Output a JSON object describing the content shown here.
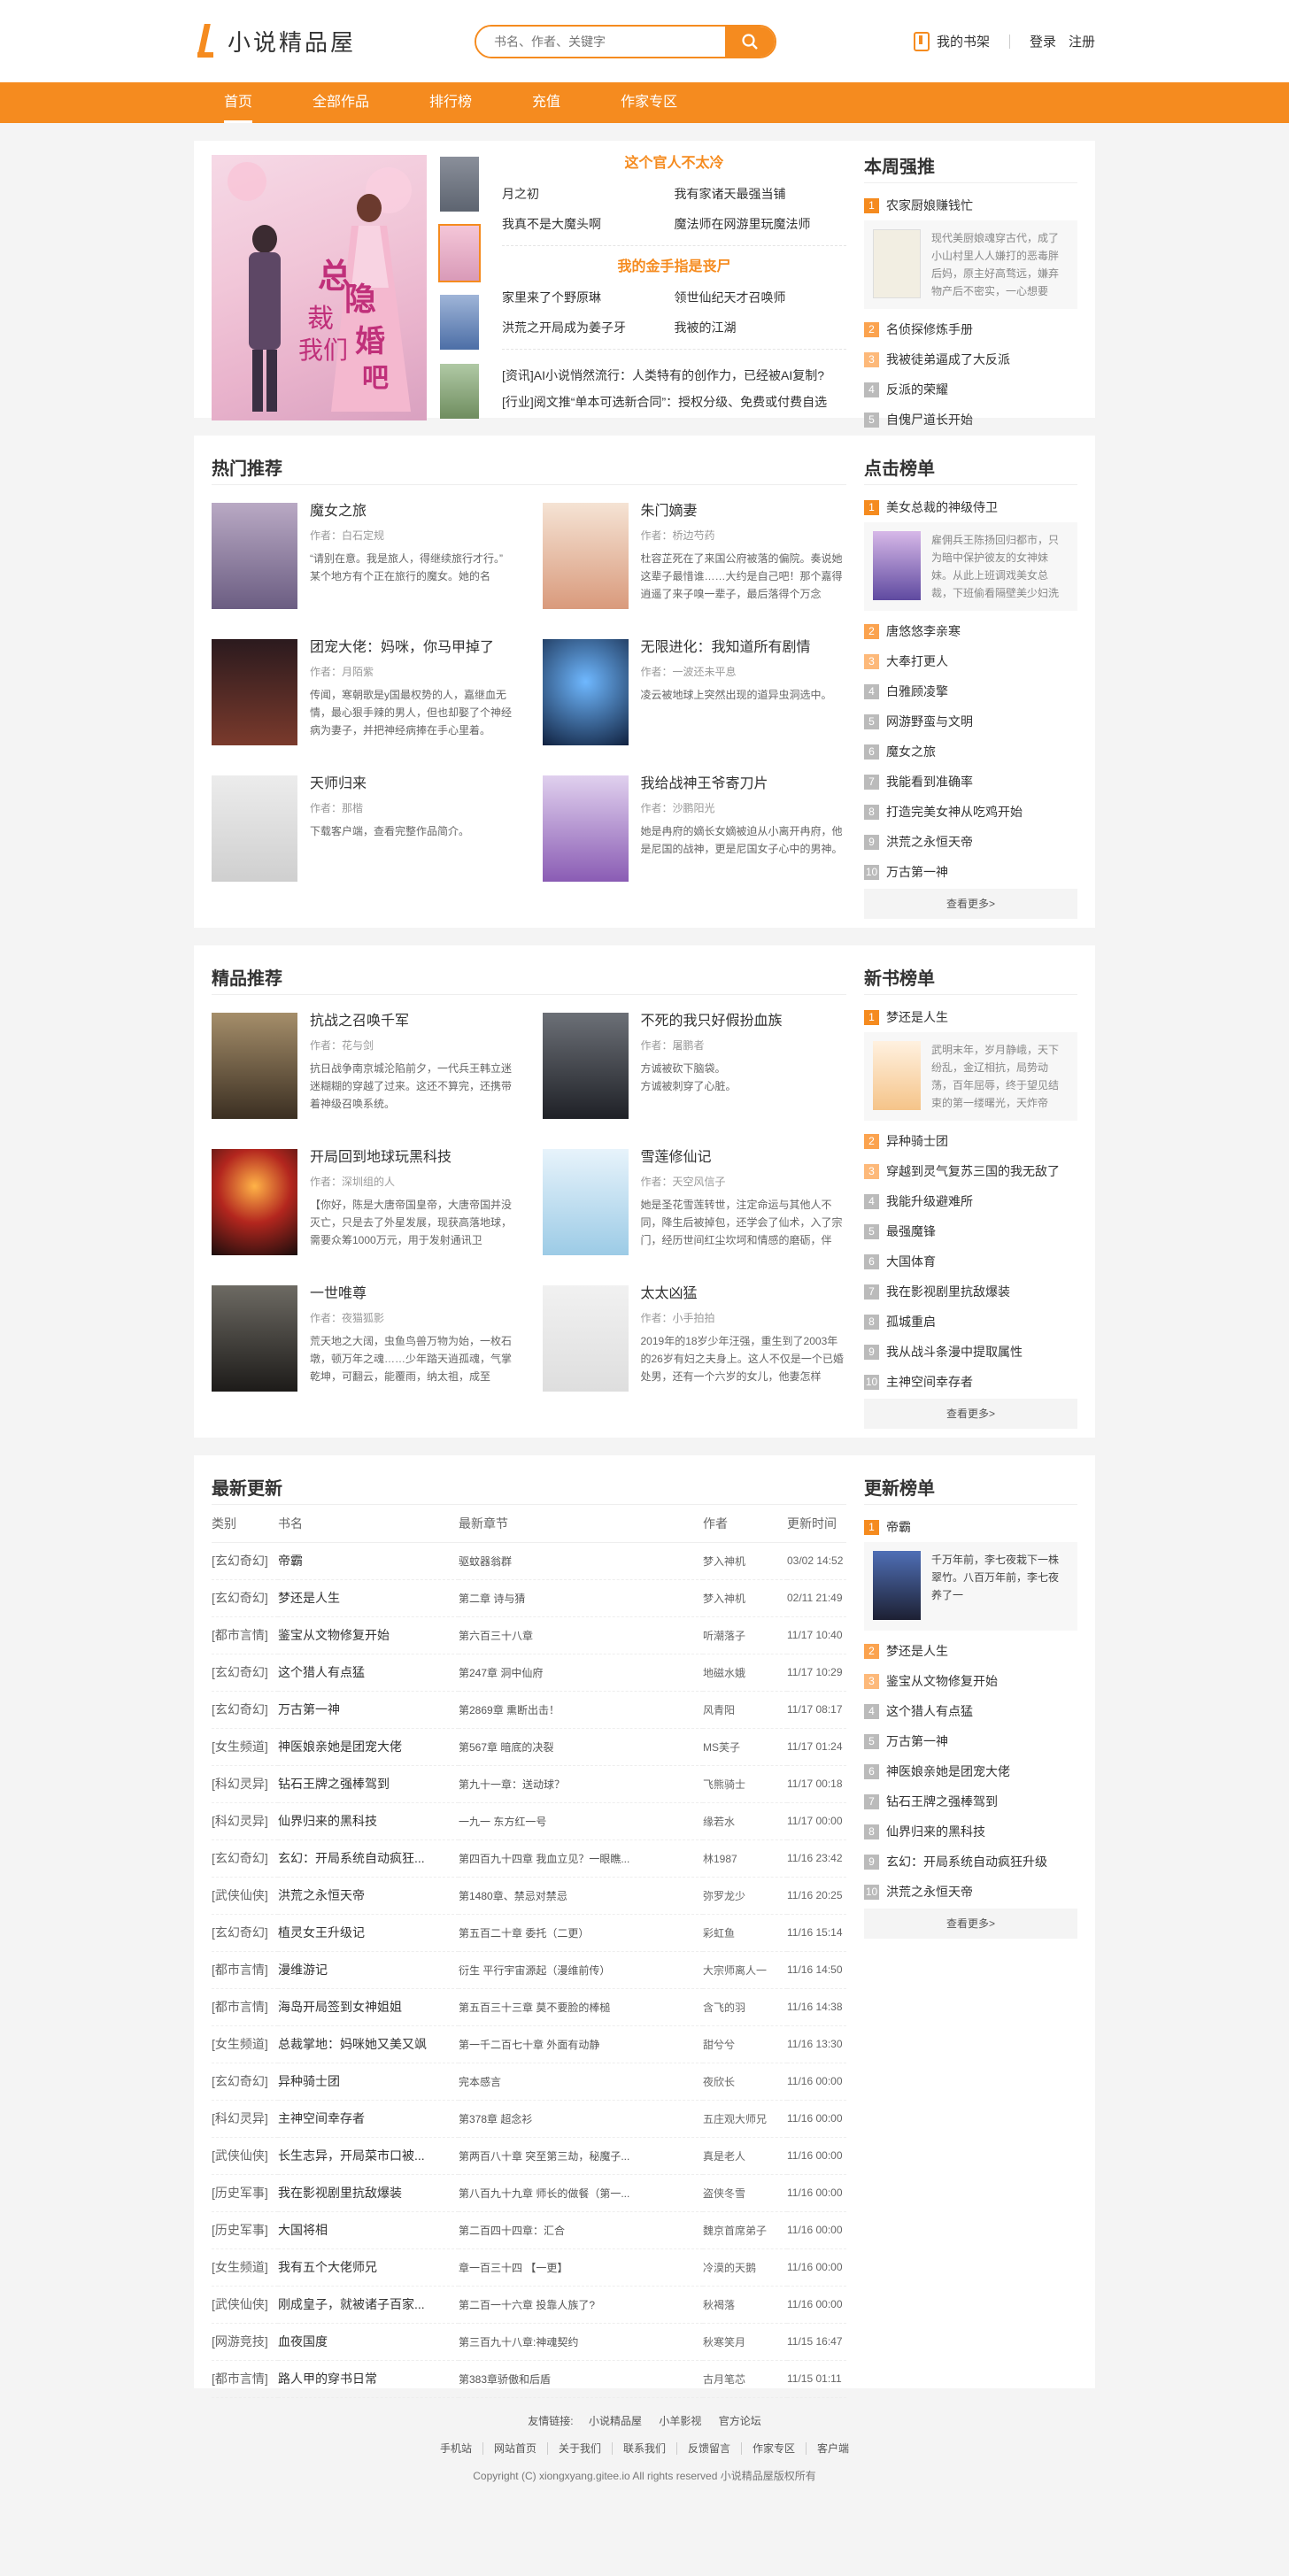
{
  "header": {
    "logo": "小说精品屋",
    "search_placeholder": "书名、作者、关键字",
    "shelf": "我的书架",
    "login": "登录",
    "register": "注册"
  },
  "nav": [
    "首页",
    "全部作品",
    "排行榜",
    "充值",
    "作家专区"
  ],
  "focus": {
    "title1": "这个官人不太冷",
    "links1": [
      "月之初",
      "我有家诸天最强当铺",
      "我真不是大魔头啊",
      "魔法师在网游里玩魔法师"
    ],
    "title2": "我的金手指是丧尸",
    "links2": [
      "家里来了个野原琳",
      "领世仙纪天才召唤师",
      "洪荒之开局成为姜子牙",
      "我被的江湖"
    ],
    "news": [
      "[资讯]AI小说悄然流行：人类特有的创作力，已经被AI复制?",
      "[行业]阅文推“单本可选新合同”：授权分级、免费或付费自选"
    ],
    "cover_text": "总裁我们隐婚吧"
  },
  "weekly": {
    "title": "本周强推",
    "top": {
      "name": "农家厨娘赚钱忙",
      "desc": "现代美厨娘魂穿古代，成了小山村里人人嫌打的恶毒胖后妈，原主好高骛远，嫌弃物产后不密实，一心想要"
    },
    "items": [
      "名侦探修炼手册",
      "我被徒弟逼成了大反派",
      "反派的荣耀",
      "自傀尸道长开始"
    ]
  },
  "hot": {
    "title": "热门推荐",
    "books": [
      {
        "name": "魔女之旅",
        "author": "作者：白石定规",
        "desc": "“请别在意。我是旅人，得继续旅行才行。” 某个地方有个正在旅行的魔女。她的名"
      },
      {
        "name": "朱门嫡妻",
        "author": "作者：桥边芍药",
        "desc": "杜容芷死在了来国公府被落的偏院。奏说她这辈子最惜谁……大约是自己吧！那个嘉得逍遥了来子嗅一辈子，最后落得个万念"
      },
      {
        "name": "团宠大佬：妈咪，你马甲掉了",
        "author": "作者：月陌紫",
        "desc": "传闻，寒朝歌是y国最权势的人，嘉继血无情，最心狠手辣的男人，但也却娶了个神经病为妻子，并把神经病捧在手心里着。"
      },
      {
        "name": "无限进化：我知道所有剧情",
        "author": "作者：一波还未平息",
        "desc": "凌云被地球上突然出现的道异虫洞选中。"
      },
      {
        "name": "天师归来",
        "author": "作者：那楷",
        "desc": "下载客户端，查看完整作品简介。"
      },
      {
        "name": "我给战神王爷寄刀片",
        "author": "作者：沙鹏阳光",
        "desc": "她是冉府的嫡长女嫡被迫从小离开冉府，他是尼国的战神，更是尼国女子心中的男神。"
      }
    ]
  },
  "click": {
    "title": "点击榜单",
    "top": {
      "name": "美女总裁的神级侍卫",
      "desc": "雇佣兵王陈扬回归都市，只为暗中保护彼友的女神妹妹。从此上班调戏美女总裁，下班偷看隔壁美少妇洗"
    },
    "items": [
      "唐悠悠李亲寒",
      "大奉打更人",
      "白雅顾凌擎",
      "网游野蛮与文明",
      "魔女之旅",
      "我能看到准确率",
      "打造完美女神从吃鸡开始",
      "洪荒之永恒天帝",
      "万古第一神"
    ],
    "more": "查看更多>"
  },
  "quality": {
    "title": "精品推荐",
    "books": [
      {
        "name": "抗战之召唤千军",
        "author": "作者：花与剑",
        "desc": "抗日战争南京城沦陷前夕，一代兵王韩立迷迷糊糊的穿越了过来。这还不算完，还携带着神级召唤系统。"
      },
      {
        "name": "不死的我只好假扮血族",
        "author": "作者：屠鹏者",
        "desc": "方诚被砍下脑袋。\n方诚被刺穿了心脏。"
      },
      {
        "name": "开局回到地球玩黑科技",
        "author": "作者：深圳组的人",
        "desc": "【你好，陈是大唐帝国皇帝，大唐帝国并没灭亡，只是去了外星发展，现获高落地球，需要众筹1000万元，用于发射通讯卫"
      },
      {
        "name": "雪莲修仙记",
        "author": "作者：天空风信子",
        "desc": "她是圣花雪莲转世，注定命运与其他人不同，降生后被掉包，还学会了仙术，入了宗门，经历世间红尘坎坷和情感的磨砺，伴"
      },
      {
        "name": "一世唯尊",
        "author": "作者：夜猫狐影",
        "desc": "荒天地之大阔，虫鱼鸟兽万物为始，一枚石墩，顿万年之魂……少年踏天逍孤魂，气掌乾坤，可翻云，能覆雨，纳太祖，成至"
      },
      {
        "name": "太太凶猛",
        "author": "作者：小手拍拍",
        "desc": "2019年的18岁少年汪强，重生到了2003年的26岁有妇之夫身上。这人不仅是一个已婚处男，还有一个六岁的女儿，他妻怎样"
      }
    ]
  },
  "newbook": {
    "title": "新书榜单",
    "top": {
      "name": "梦还是人生",
      "desc": "武明末年，岁月静峨，天下纷乱，金辽相抗，局势动荡，百年屈辱，终于望见结束的第一缕曙光，天炸帝"
    },
    "items": [
      "异种骑士团",
      "穿越到灵气复苏三国的我无敌了",
      "我能升级避难所",
      "最强魔锋",
      "大国体育",
      "我在影视剧里抗敌爆装",
      "孤城重启",
      "我从战斗条漫中提取属性",
      "主神空间幸存者"
    ],
    "more": "查看更多>"
  },
  "latest": {
    "title": "最新更新",
    "headers": [
      "类别",
      "书名",
      "最新章节",
      "作者",
      "更新时间"
    ],
    "rows": [
      [
        "[玄幻奇幻]",
        "帝霸",
        "驱蚊器翁群",
        "梦入神机",
        "03/02 14:52"
      ],
      [
        "[玄幻奇幻]",
        "梦还是人生",
        "第二章 诗与猜",
        "梦入神机",
        "02/11 21:49"
      ],
      [
        "[都市言情]",
        "鉴宝从文物修复开始",
        "第六百三十八章",
        "听潮落子",
        "11/17 10:40"
      ],
      [
        "[玄幻奇幻]",
        "这个猎人有点猛",
        "第247章 洞中仙府",
        "地磁水娥",
        "11/17 10:29"
      ],
      [
        "[玄幻奇幻]",
        "万古第一神",
        "第2869章 熏断出击！",
        "风青阳",
        "11/17 08:17"
      ],
      [
        "[女生频道]",
        "神医娘亲她是团宠大佬",
        "第567章 暗底的决裂",
        "MS芙子",
        "11/17 01:24"
      ],
      [
        "[科幻灵异]",
        "钻石王牌之强棒驾到",
        "第九十一章：送动球？",
        "飞熊骑士",
        "11/17 00:18"
      ],
      [
        "[科幻灵异]",
        "仙界归来的黑科技",
        "一九一 东方红一号",
        "缘若水",
        "11/17 00:00"
      ],
      [
        "[玄幻奇幻]",
        "玄幻：开局系统自动疯狂...",
        "第四百九十四章 我血立见？一眼瞧...",
        "林1987",
        "11/16 23:42"
      ],
      [
        "[武侠仙侠]",
        "洪荒之永恒天帝",
        "第1480章、禁忌对禁忌",
        "弥罗龙少",
        "11/16 20:25"
      ],
      [
        "[玄幻奇幻]",
        "植灵女王升级记",
        "第五百二十章 委托（二更）",
        "彩虹鱼",
        "11/16 15:14"
      ],
      [
        "[都市言情]",
        "漫维游记",
        "衍生 平行宇宙源起（漫维前传）",
        "大宗师离人一",
        "11/16 14:50"
      ],
      [
        "[都市言情]",
        "海岛开局签到女神姐姐",
        "第五百三十三章 莫不要脸的棒槌",
        "含飞的羽",
        "11/16 14:38"
      ],
      [
        "[女生频道]",
        "总裁掌地：妈咪她又美又飒",
        "第一千二百七十章 外面有动静",
        "甜兮兮",
        "11/16 13:30"
      ],
      [
        "[玄幻奇幻]",
        "异种骑士团",
        "完本感言",
        "夜欣长",
        "11/16 00:00"
      ],
      [
        "[科幻灵异]",
        "主神空间幸存者",
        "第378章 超念衫",
        "五庄观大师兄",
        "11/16 00:00"
      ],
      [
        "[武侠仙侠]",
        "长生志异，开局菜市口被...",
        "第两百八十章 突至第三劫，秘魔子...",
        "真是老人",
        "11/16 00:00"
      ],
      [
        "[历史军事]",
        "我在影视剧里抗敌爆装",
        "第八百九十九章 师长的做餐（第一...",
        "盗侠冬雪",
        "11/16 00:00"
      ],
      [
        "[历史军事]",
        "大国将相",
        "第二百四十四章：汇合",
        "魏京首席弟子",
        "11/16 00:00"
      ],
      [
        "[女生频道]",
        "我有五个大佬师兄",
        "章一百三十四 【一更】",
        "冷漠的天鹅",
        "11/16 00:00"
      ],
      [
        "[武侠仙侠]",
        "刚成皇子，就被诸子百家...",
        "第二百一十六章 投靠人族了?",
        "秋褐落",
        "11/16 00:00"
      ],
      [
        "[网游竞技]",
        "血夜国度",
        "第三百九十八章:神魂契约",
        "秋寒笑月",
        "11/15 16:47"
      ],
      [
        "[都市言情]",
        "路人甲的穿书日常",
        "第383章骄傲和后盾",
        "古月笔芯",
        "11/15 01:11"
      ]
    ]
  },
  "update": {
    "title": "更新榜单",
    "top": {
      "name": "帝霸",
      "desc": "千万年前，李七夜栽下一株翠竹。八百万年前，李七夜养了一"
    },
    "items": [
      "梦还是人生",
      "鉴宝从文物修复开始",
      "这个猎人有点猛",
      "万古第一神",
      "神医娘亲她是团宠大佬",
      "钻石王牌之强棒驾到",
      "仙界归来的黑科技",
      "玄幻：开局系统自动疯狂升级",
      "洪荒之永恒天帝"
    ],
    "more": "查看更多>"
  },
  "footer": {
    "friend_label": "友情链接:",
    "friends": [
      "小说精品屋",
      "小羊影视",
      "官方论坛"
    ],
    "links": [
      "手机站",
      "网站首页",
      "关于我们",
      "联系我们",
      "反馈留言",
      "作家专区",
      "客户端"
    ],
    "copyright": "Copyright (C) xiongxyang.gitee.io All rights reserved  小说精品屋版权所有"
  },
  "colors": {
    "accent": "#f58b1f",
    "background": "#f4f4f4"
  }
}
